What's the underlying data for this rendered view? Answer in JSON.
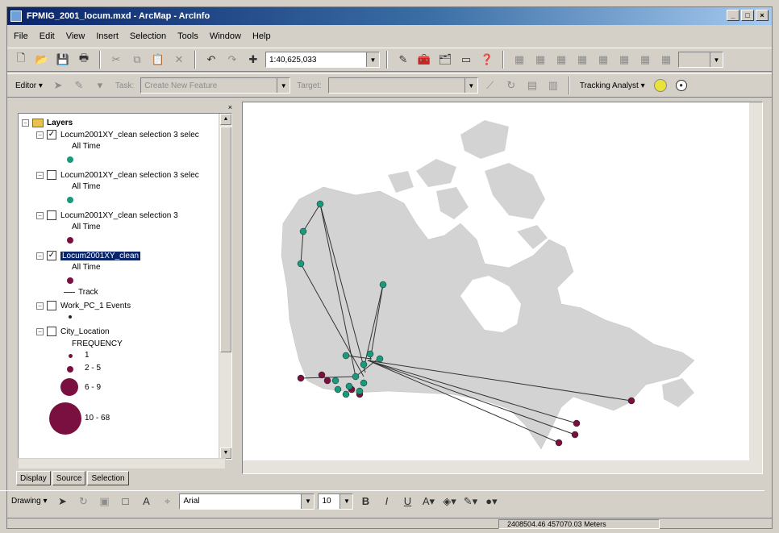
{
  "window": {
    "title": "FPMIG_2001_locum.mxd - ArcMap - ArcInfo",
    "controls": [
      "_",
      "□",
      "×"
    ]
  },
  "menu": [
    "File",
    "Edit",
    "View",
    "Insert",
    "Selection",
    "Tools",
    "Window",
    "Help"
  ],
  "toolbar1": {
    "scale": "1:40,625,033"
  },
  "toolbar2": {
    "editor_label": "Editor ▾",
    "task_value": "Create New Feature",
    "target_label": "Target:",
    "target_value": "",
    "tracking_label": "Tracking Analyst ▾"
  },
  "toc": {
    "root_label": "Layers",
    "layers": [
      {
        "name": "Locum2001XY_clean selection 3 selec",
        "checked": true,
        "sub": "All Time",
        "color": "#1a9a7c"
      },
      {
        "name": "Locum2001XY_clean selection 3 selec",
        "checked": false,
        "sub": "All Time",
        "color": "#1a9a7c"
      },
      {
        "name": "Locum2001XY_clean selection 3",
        "checked": false,
        "sub": "All Time",
        "color": "#7a1040"
      },
      {
        "name": "Locum2001XY_clean",
        "checked": true,
        "sub": "All Time",
        "color": "#7a1040",
        "track_label": "Track"
      },
      {
        "name": "Work_PC_1 Events",
        "checked": false
      },
      {
        "name": "City_Location",
        "checked": false,
        "sub": "FREQUENCY"
      }
    ],
    "frequency_classes": [
      {
        "label": "1"
      },
      {
        "label": "2 - 5"
      },
      {
        "label": "6 - 9"
      },
      {
        "label": "10 - 68"
      }
    ],
    "tabs": [
      "Display",
      "Source",
      "Selection"
    ]
  },
  "drawing_toolbar": {
    "drawing_label": "Drawing ▾",
    "font": "Arial",
    "font_size": "10",
    "bold": "B",
    "italic": "I",
    "underline": "U"
  },
  "status": {
    "coords": "2408504.46 457070.03 Meters"
  },
  "colors": {
    "land": "#d3d3d3",
    "teal_point": "#1a9a7c",
    "maroon_point": "#7a1040",
    "track": "#333333",
    "title_start": "#0a246a",
    "title_end": "#a6caf0"
  }
}
